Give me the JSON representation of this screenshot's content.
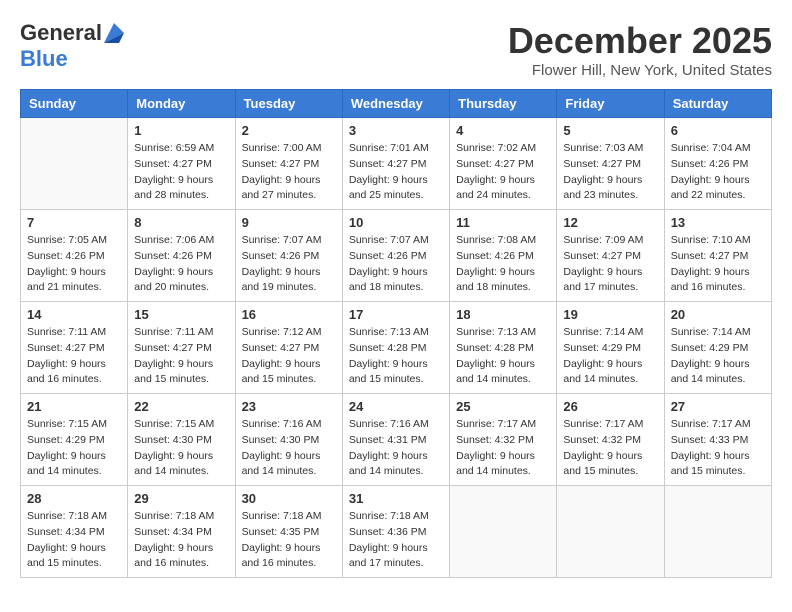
{
  "logo": {
    "general": "General",
    "blue": "Blue"
  },
  "title": "December 2025",
  "location": "Flower Hill, New York, United States",
  "days_of_week": [
    "Sunday",
    "Monday",
    "Tuesday",
    "Wednesday",
    "Thursday",
    "Friday",
    "Saturday"
  ],
  "weeks": [
    [
      {
        "day": "",
        "info": ""
      },
      {
        "day": "1",
        "info": "Sunrise: 6:59 AM\nSunset: 4:27 PM\nDaylight: 9 hours\nand 28 minutes."
      },
      {
        "day": "2",
        "info": "Sunrise: 7:00 AM\nSunset: 4:27 PM\nDaylight: 9 hours\nand 27 minutes."
      },
      {
        "day": "3",
        "info": "Sunrise: 7:01 AM\nSunset: 4:27 PM\nDaylight: 9 hours\nand 25 minutes."
      },
      {
        "day": "4",
        "info": "Sunrise: 7:02 AM\nSunset: 4:27 PM\nDaylight: 9 hours\nand 24 minutes."
      },
      {
        "day": "5",
        "info": "Sunrise: 7:03 AM\nSunset: 4:27 PM\nDaylight: 9 hours\nand 23 minutes."
      },
      {
        "day": "6",
        "info": "Sunrise: 7:04 AM\nSunset: 4:26 PM\nDaylight: 9 hours\nand 22 minutes."
      }
    ],
    [
      {
        "day": "7",
        "info": "Sunrise: 7:05 AM\nSunset: 4:26 PM\nDaylight: 9 hours\nand 21 minutes."
      },
      {
        "day": "8",
        "info": "Sunrise: 7:06 AM\nSunset: 4:26 PM\nDaylight: 9 hours\nand 20 minutes."
      },
      {
        "day": "9",
        "info": "Sunrise: 7:07 AM\nSunset: 4:26 PM\nDaylight: 9 hours\nand 19 minutes."
      },
      {
        "day": "10",
        "info": "Sunrise: 7:07 AM\nSunset: 4:26 PM\nDaylight: 9 hours\nand 18 minutes."
      },
      {
        "day": "11",
        "info": "Sunrise: 7:08 AM\nSunset: 4:26 PM\nDaylight: 9 hours\nand 18 minutes."
      },
      {
        "day": "12",
        "info": "Sunrise: 7:09 AM\nSunset: 4:27 PM\nDaylight: 9 hours\nand 17 minutes."
      },
      {
        "day": "13",
        "info": "Sunrise: 7:10 AM\nSunset: 4:27 PM\nDaylight: 9 hours\nand 16 minutes."
      }
    ],
    [
      {
        "day": "14",
        "info": "Sunrise: 7:11 AM\nSunset: 4:27 PM\nDaylight: 9 hours\nand 16 minutes."
      },
      {
        "day": "15",
        "info": "Sunrise: 7:11 AM\nSunset: 4:27 PM\nDaylight: 9 hours\nand 15 minutes."
      },
      {
        "day": "16",
        "info": "Sunrise: 7:12 AM\nSunset: 4:27 PM\nDaylight: 9 hours\nand 15 minutes."
      },
      {
        "day": "17",
        "info": "Sunrise: 7:13 AM\nSunset: 4:28 PM\nDaylight: 9 hours\nand 15 minutes."
      },
      {
        "day": "18",
        "info": "Sunrise: 7:13 AM\nSunset: 4:28 PM\nDaylight: 9 hours\nand 14 minutes."
      },
      {
        "day": "19",
        "info": "Sunrise: 7:14 AM\nSunset: 4:29 PM\nDaylight: 9 hours\nand 14 minutes."
      },
      {
        "day": "20",
        "info": "Sunrise: 7:14 AM\nSunset: 4:29 PM\nDaylight: 9 hours\nand 14 minutes."
      }
    ],
    [
      {
        "day": "21",
        "info": "Sunrise: 7:15 AM\nSunset: 4:29 PM\nDaylight: 9 hours\nand 14 minutes."
      },
      {
        "day": "22",
        "info": "Sunrise: 7:15 AM\nSunset: 4:30 PM\nDaylight: 9 hours\nand 14 minutes."
      },
      {
        "day": "23",
        "info": "Sunrise: 7:16 AM\nSunset: 4:30 PM\nDaylight: 9 hours\nand 14 minutes."
      },
      {
        "day": "24",
        "info": "Sunrise: 7:16 AM\nSunset: 4:31 PM\nDaylight: 9 hours\nand 14 minutes."
      },
      {
        "day": "25",
        "info": "Sunrise: 7:17 AM\nSunset: 4:32 PM\nDaylight: 9 hours\nand 14 minutes."
      },
      {
        "day": "26",
        "info": "Sunrise: 7:17 AM\nSunset: 4:32 PM\nDaylight: 9 hours\nand 15 minutes."
      },
      {
        "day": "27",
        "info": "Sunrise: 7:17 AM\nSunset: 4:33 PM\nDaylight: 9 hours\nand 15 minutes."
      }
    ],
    [
      {
        "day": "28",
        "info": "Sunrise: 7:18 AM\nSunset: 4:34 PM\nDaylight: 9 hours\nand 15 minutes."
      },
      {
        "day": "29",
        "info": "Sunrise: 7:18 AM\nSunset: 4:34 PM\nDaylight: 9 hours\nand 16 minutes."
      },
      {
        "day": "30",
        "info": "Sunrise: 7:18 AM\nSunset: 4:35 PM\nDaylight: 9 hours\nand 16 minutes."
      },
      {
        "day": "31",
        "info": "Sunrise: 7:18 AM\nSunset: 4:36 PM\nDaylight: 9 hours\nand 17 minutes."
      },
      {
        "day": "",
        "info": ""
      },
      {
        "day": "",
        "info": ""
      },
      {
        "day": "",
        "info": ""
      }
    ]
  ]
}
